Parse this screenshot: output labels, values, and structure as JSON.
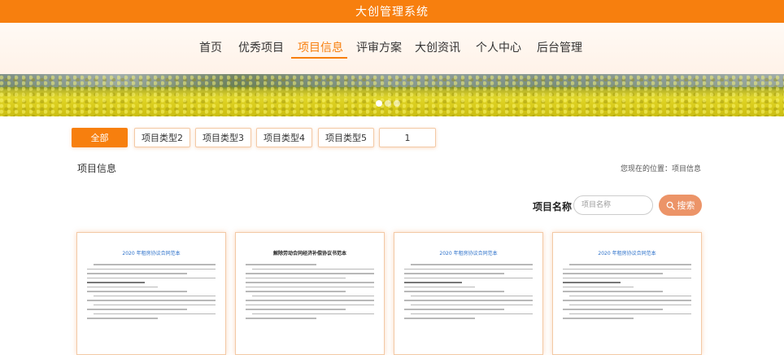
{
  "app_title": "大创管理系统",
  "nav": {
    "items": [
      {
        "label": "首页"
      },
      {
        "label": "优秀项目"
      },
      {
        "label": "项目信息"
      },
      {
        "label": "评审方案"
      },
      {
        "label": "大创资讯"
      },
      {
        "label": "个人中心"
      },
      {
        "label": "后台管理"
      }
    ],
    "active_index": 2
  },
  "banner": {
    "slide_count": 3,
    "active_slide": 0
  },
  "filters": {
    "items": [
      "全部",
      "项目类型2",
      "项目类型3",
      "项目类型4",
      "项目类型5",
      "1"
    ],
    "active_index": 0
  },
  "section": {
    "title": "项目信息",
    "breadcrumb": "您现在的位置：项目信息"
  },
  "search": {
    "label": "项目名称",
    "placeholder": "项目名称",
    "value": "",
    "button_label": "搜索",
    "button_icon": "search-icon"
  },
  "cards": [
    {
      "doc_title": "2020 年租房协议合同范本"
    },
    {
      "doc_title": "解除劳动合同经济补偿协议书范本"
    },
    {
      "doc_title": "2020 年租房协议合同范本"
    },
    {
      "doc_title": "2020 年租房协议合同范本"
    }
  ],
  "colors": {
    "accent": "#f77f0e",
    "search_button": "#ec9468",
    "doc_title_blue": "#2a6fc9"
  }
}
